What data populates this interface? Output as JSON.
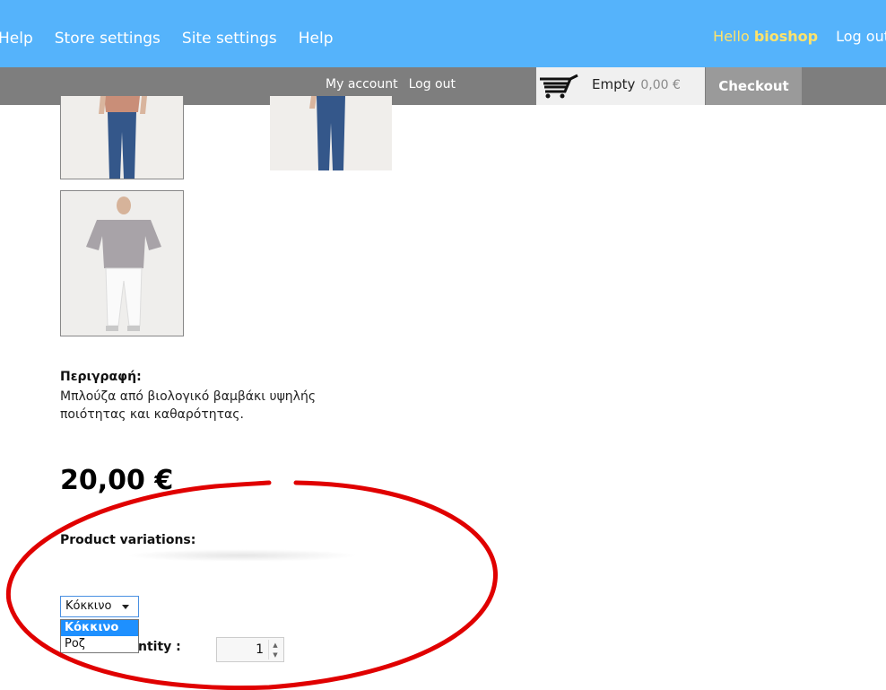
{
  "topbar": {
    "nav": [
      "Help",
      "Store settings",
      "Site settings",
      "Help"
    ],
    "hello_prefix": "Hello",
    "username": "bioshop",
    "logout": "Log out"
  },
  "subbar": {
    "my_account": "My account",
    "logout": "Log out",
    "cart_empty": "Empty",
    "cart_amount": "0,00 €",
    "checkout": "Checkout"
  },
  "product": {
    "description_title": "Περιγραφή:",
    "description_text": "Μπλούζα από βιολογικό βαμβάκι υψηλής ποιότητας και καθαρότητας.",
    "price": "20,00 €",
    "variations_title": "Product variations:",
    "variation_selected": "Κόκκινο",
    "variation_options": [
      "Κόκκινο",
      "Ροζ"
    ],
    "quantity_label_visible": "ntity :",
    "quantity_value": "1"
  },
  "colors": {
    "topbar": "#55b3fb",
    "subbar": "#7e7e7e",
    "username": "#ffe36b",
    "annotation": "#e00000"
  }
}
